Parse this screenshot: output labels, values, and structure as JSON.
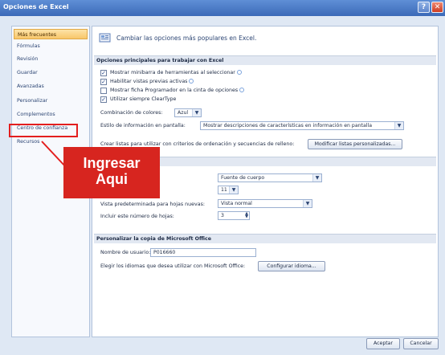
{
  "window": {
    "title": "Opciones de Excel"
  },
  "sidebar": {
    "items": [
      {
        "label": "Más frecuentes"
      },
      {
        "label": "Fórmulas"
      },
      {
        "label": "Revisión"
      },
      {
        "label": "Guardar"
      },
      {
        "label": "Avanzadas"
      },
      {
        "label": "Personalizar"
      },
      {
        "label": "Complementos"
      },
      {
        "label": "Centro de confianza"
      },
      {
        "label": "Recursos"
      }
    ]
  },
  "content": {
    "heading": "Cambiar las opciones más populares en Excel.",
    "section1": {
      "title": "Opciones principales para trabajar con Excel",
      "opt1": "Mostrar minibarra de herramientas al seleccionar",
      "opt2": "Habilitar vistas previas activas",
      "opt3": "Mostrar ficha Programador en la cinta de opciones",
      "opt4": "Utilizar siempre ClearType",
      "color_label": "Combinación de colores:",
      "color_value": "Azul",
      "tip_label": "Estilo de información en pantalla:",
      "tip_value": "Mostrar descripciones de características en información en pantalla",
      "lists_label": "Crear listas para utilizar con criterios de ordenación y secuencias de relleno:",
      "lists_button": "Modificar listas personalizadas..."
    },
    "section2": {
      "font_value": "Fuente de cuerpo",
      "size_value": "11",
      "view_label": "Vista predeterminada para hojas nuevas:",
      "view_value": "Vista normal",
      "sheets_label": "Incluir este número de hojas:",
      "sheets_value": "3"
    },
    "section3": {
      "title": "Personalizar la copia de Microsoft Office",
      "user_label": "Nombre de usuario:",
      "user_value": "P016660",
      "lang_label": "Elegir los idiomas que desea utilizar con Microsoft Office:",
      "lang_button": "Configurar idioma..."
    }
  },
  "callout": {
    "line1": "Ingresar",
    "line2": "Aqui"
  },
  "footer": {
    "ok": "Aceptar",
    "cancel": "Cancelar"
  }
}
